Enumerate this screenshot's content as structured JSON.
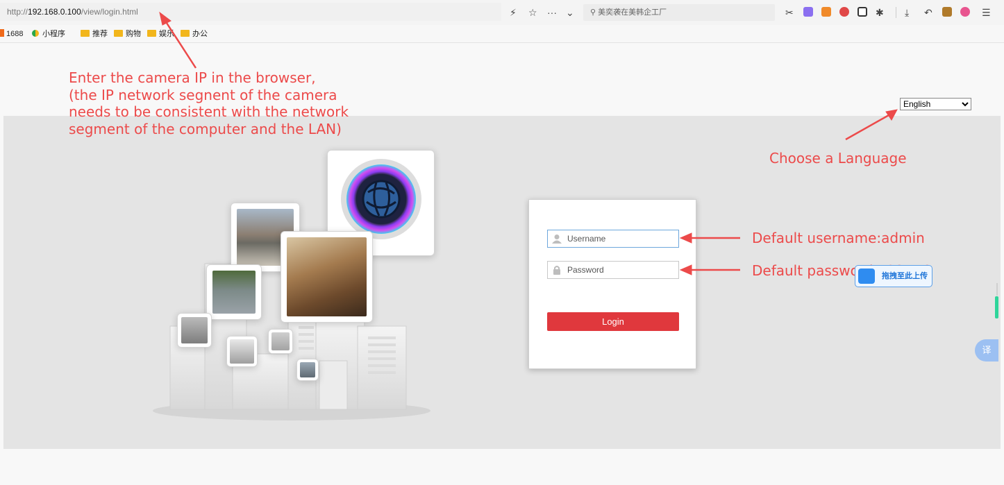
{
  "browser": {
    "url_scheme": "http://",
    "url_host": "192.168.0.100",
    "url_path": "/view/login.html",
    "search_placeholder": "美奕袭在美韩企工厂",
    "bookmarks": [
      "1688",
      "小程序",
      "推荐",
      "购物",
      "娱乐",
      "办公"
    ]
  },
  "page": {
    "language_options": [
      "English"
    ],
    "language_selected": "English"
  },
  "login": {
    "username_placeholder": "Username",
    "password_placeholder": "Password",
    "login_label": "Login"
  },
  "annotations": {
    "ip_note": [
      "Enter the camera IP in the browser,",
      "(the IP network segnent of the camera",
      "needs to be consistent with the network",
      "segment of the computer and the LAN)"
    ],
    "language_note": "Choose a Language",
    "username_note": "Default username:admin",
    "password_note": "Default password:123456"
  },
  "widgets": {
    "upload_label": "拖拽至此上传",
    "translate_label": "译"
  },
  "colors": {
    "annotation": "#ec4a4a",
    "login_button": "#e0383d",
    "band": "#e4e4e4"
  }
}
